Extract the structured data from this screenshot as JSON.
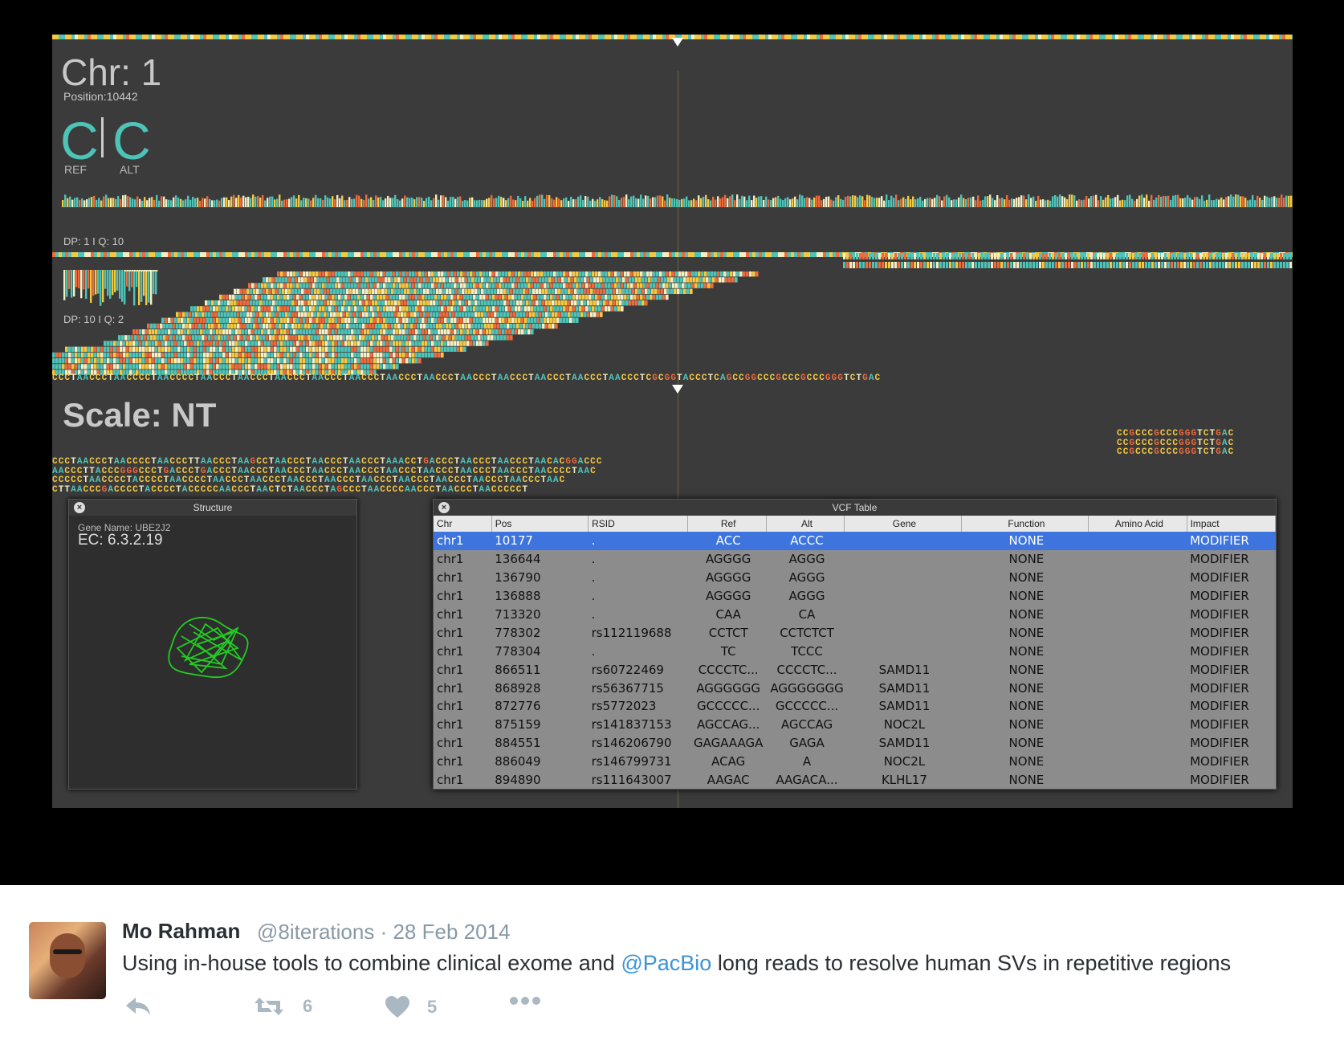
{
  "app": {
    "chr_title": "Chr: 1",
    "position": "Position:10442",
    "ref_base": "C",
    "alt_base": "C",
    "ref_label": "REF",
    "alt_label": "ALT",
    "track1_label": "DP: 1 I Q: 10",
    "track2_label": "DP: 10 I Q: 2",
    "scale_label": "Scale: NT",
    "ref_sequence": "CCCTAACCCTAACCCCTAACCCCTAACCCTAACCCTAACCCTAACCCTAACCCTAACCCTAACCCTAACCCTAACCCTAACCCTAACCCTAACCCTCGCGGTACCCTCAGCCGGCCCGCCCGCCCGGGTCTGAC",
    "read_lines": [
      "CCCTAACCCTAACCCCTAACCCTTAACCCTAAGCCTAACCCTAACCCTAACCCTAAACCTGACCCTAACCCTAACCCTAACACGGACCC",
      "AACCCTTACCCGGGCCCTGACCCTGACCCTAACCCTAACCCTAACCCTAACCCTAACCCTAACCCTAACCCTAACCCTAACCCCTAAC",
      "CCCCCTAACCCCTACCCCTAACCCCTAACCCTAACCCTAACCCTAACCCTAACCCTAACCCTAACCCTAACCCTAACCCTAAC",
      "CTTAACCCGACCCCTACCCCTACCCCCAACCCTAACTCTAACCCTAGCCCTAACCCCAACCCTAACCCTAACCCCCT"
    ],
    "right_seq_lines": [
      "CCGCCCGCCCGGGTCTGAC",
      "CCGCCCGCCCGGGTCTGAC",
      "CCGCCCGCCCGGGTCTGAC"
    ]
  },
  "structure_panel": {
    "title": "Structure",
    "close_icon": "×",
    "gene_name": "Gene Name: UBE2J2",
    "ec": "EC: 6.3.2.19"
  },
  "vcf_panel": {
    "title": "VCF Table",
    "close_icon": "×",
    "columns": [
      "Chr",
      "Pos",
      "RSID",
      "Ref",
      "Alt",
      "Gene",
      "Function",
      "Amino Acid",
      "Impact"
    ],
    "rows": [
      [
        "chr1",
        "10177",
        ".",
        "ACC",
        "ACCC",
        "",
        "NONE",
        "",
        "MODIFIER"
      ],
      [
        "chr1",
        "136644",
        ".",
        "AGGGG",
        "AGGG",
        "",
        "NONE",
        "",
        "MODIFIER"
      ],
      [
        "chr1",
        "136790",
        ".",
        "AGGGG",
        "AGGG",
        "",
        "NONE",
        "",
        "MODIFIER"
      ],
      [
        "chr1",
        "136888",
        ".",
        "AGGGG",
        "AGGG",
        "",
        "NONE",
        "",
        "MODIFIER"
      ],
      [
        "chr1",
        "713320",
        ".",
        "CAA",
        "CA",
        "",
        "NONE",
        "",
        "MODIFIER"
      ],
      [
        "chr1",
        "778302",
        "rs112119688",
        "CCTCT",
        "CCTCTCT",
        "",
        "NONE",
        "",
        "MODIFIER"
      ],
      [
        "chr1",
        "778304",
        ".",
        "TC",
        "TCCC",
        "",
        "NONE",
        "",
        "MODIFIER"
      ],
      [
        "chr1",
        "866511",
        "rs60722469",
        "CCCCTC...",
        "CCCCTC...",
        "SAMD11",
        "NONE",
        "",
        "MODIFIER"
      ],
      [
        "chr1",
        "868928",
        "rs56367715",
        "AGGGGGG",
        "AGGGGGGG",
        "SAMD11",
        "NONE",
        "",
        "MODIFIER"
      ],
      [
        "chr1",
        "872776",
        "rs5772023",
        "GCCCCC...",
        "GCCCCC...",
        "SAMD11",
        "NONE",
        "",
        "MODIFIER"
      ],
      [
        "chr1",
        "875159",
        "rs141837153",
        "AGCCAG...",
        "AGCCAG",
        "NOC2L",
        "NONE",
        "",
        "MODIFIER"
      ],
      [
        "chr1",
        "884551",
        "rs146206790",
        "GAGAAAGA",
        "GAGA",
        "SAMD11",
        "NONE",
        "",
        "MODIFIER"
      ],
      [
        "chr1",
        "886049",
        "rs146799731",
        "ACAG",
        "A",
        "NOC2L",
        "NONE",
        "",
        "MODIFIER"
      ],
      [
        "chr1",
        "894890",
        "rs111643007",
        "AAGAC",
        "AAGACA...",
        "KLHL17",
        "NONE",
        "",
        "MODIFIER"
      ]
    ],
    "selected_row": 0
  },
  "tweet": {
    "name": "Mo Rahman",
    "handle_date": "@8iterations · 28 Feb 2014",
    "text_before": "Using in-house tools to combine clinical exome and ",
    "mention": "@PacBio",
    "text_after": " long reads to resolve human SVs in repetitive regions",
    "retweet_count": "6",
    "like_count": "5",
    "icons": [
      "reply-icon",
      "retweet-icon",
      "heart-icon",
      "more-icon"
    ]
  },
  "colors": {
    "teal": "#4ec4b9",
    "yellow": "#f5c842",
    "orange": "#ef6a3c",
    "cream": "#f4eec2",
    "selection": "#3d74dd",
    "mention": "#3b94d9"
  }
}
